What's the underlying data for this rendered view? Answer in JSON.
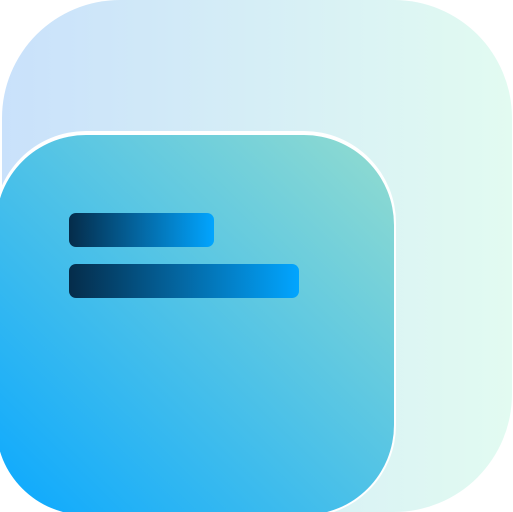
{
  "icon": {
    "name": "stacked-cards-text-icon",
    "colors": {
      "back_card_start": "#c9e1fb",
      "back_card_end": "#e2fbf1",
      "front_card_bottom_left": "#0aa8ff",
      "front_card_top_right": "#93dccf",
      "front_card_outline": "#ffffff",
      "text_line_start": "#052c4a",
      "text_line_end": "#02a5ff"
    }
  }
}
